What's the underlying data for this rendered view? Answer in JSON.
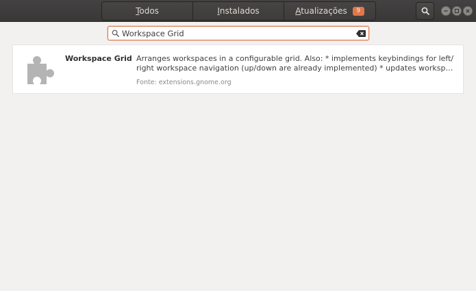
{
  "header": {
    "tabs": [
      {
        "label": "Todos"
      },
      {
        "label": "Instalados"
      },
      {
        "label": "Atualizações",
        "badge": "9"
      }
    ],
    "search_icon": "search-icon",
    "window_buttons": [
      "minimize-icon",
      "maximize-icon",
      "close-icon"
    ]
  },
  "search": {
    "value": "Workspace Grid",
    "placeholder": ""
  },
  "results": [
    {
      "name": "Workspace Grid",
      "icon": "puzzle-piece-icon",
      "description_line1": "Arranges workspaces in a configurable grid. Also: * implements keybindings for left/",
      "description_line2": "right workspace navigation (up/down are already implemented) * updates workspaces …",
      "source": "Fonte: extensions.gnome.org"
    }
  ],
  "colors": {
    "accent": "#e0774b",
    "header_bg": "#3a3837",
    "window_bg": "#f2f1f0"
  }
}
